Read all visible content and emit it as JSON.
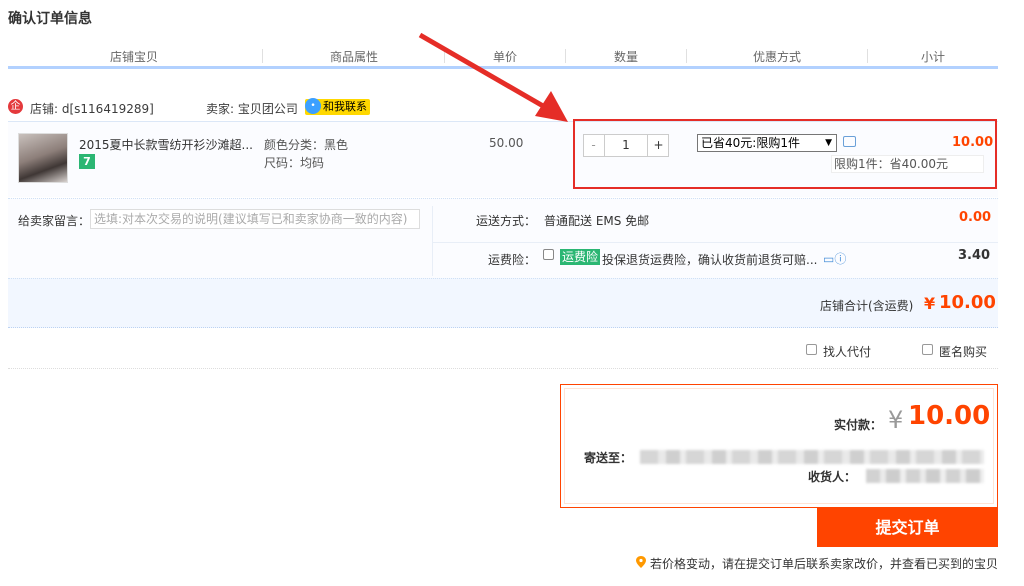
{
  "page_title": "确认订单信息",
  "columns": [
    "店铺宝贝",
    "商品属性",
    "单价",
    "数量",
    "优惠方式",
    "小计"
  ],
  "shop": {
    "icon": "shop-icon",
    "shop_label": "店铺: d[s116419289]",
    "seller_label": "卖家: 宝贝团公司",
    "contact_label": "和我联系"
  },
  "item": {
    "title": "2015夏中长款雪纺开衫沙滩超...",
    "badge": "7",
    "attr_color": "颜色分类：黑色",
    "attr_size": "尺码：均码",
    "price": "50.00",
    "qty_minus": "-",
    "qty": "1",
    "qty_plus": "+",
    "promo_selected": "已省40元:限购1件",
    "promo_note": "限购1件：省40.00元",
    "subtotal": "10.00"
  },
  "shipping": {
    "message_label": "给卖家留言：",
    "message_placeholder": "选填:对本次交易的说明(建议填写已和卖家协商一致的内容)",
    "method_label": "运送方式：",
    "method_value": "普通配送 EMS 免邮",
    "method_fee": "0.00",
    "insurance_label": "运费险：",
    "insurance_tag": "运费险",
    "insurance_text": "投保退货运费险，确认收货前退货可赔...",
    "insurance_fee": "3.40"
  },
  "shop_total": {
    "label": "店铺合计(含运费)",
    "currency": "¥",
    "value": "10.00"
  },
  "options": {
    "proxy_pay": "找人代付",
    "anonymous": "匿名购买"
  },
  "payment": {
    "paid_label": "实付款：",
    "currency": "¥",
    "paid_value": "10.00",
    "address_label": "寄送至：",
    "receiver_label": "收货人："
  },
  "submit_label": "提交订单",
  "footer_note": "若价格变动，请在提交订单后联系卖家改价，并查看已买到的宝贝",
  "colors": {
    "accent": "#ff4400",
    "highlight": "#e52d27",
    "header_line": "#b2d1ff",
    "tag_green": "#2bb673"
  }
}
